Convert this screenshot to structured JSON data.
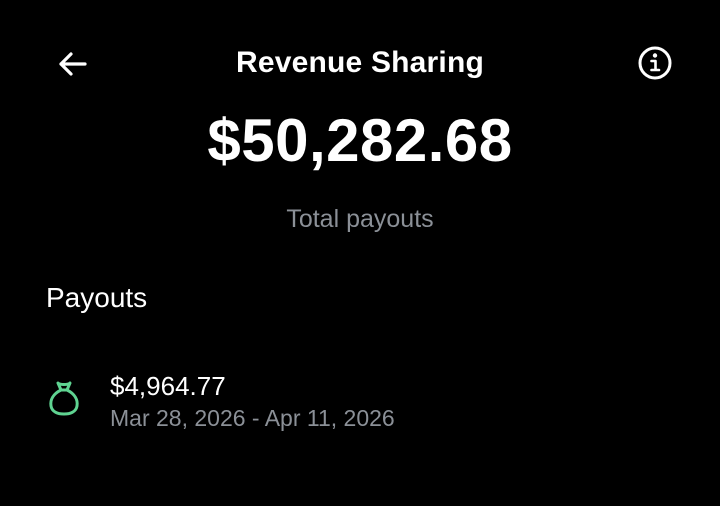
{
  "header": {
    "title": "Revenue Sharing",
    "back_icon": "arrow-left-icon",
    "info_icon": "info-circle-icon"
  },
  "summary": {
    "total_amount": "$50,282.68",
    "total_label": "Total payouts"
  },
  "payouts": {
    "heading": "Payouts",
    "items": [
      {
        "amount": "$4,964.77",
        "date_range": "Mar 28, 2026 - Apr 11, 2026",
        "icon": "money-bag-icon"
      }
    ]
  },
  "colors": {
    "background": "#000000",
    "primary_text": "#ffffff",
    "secondary_text": "#8b9097",
    "accent_green": "#5fd391"
  }
}
